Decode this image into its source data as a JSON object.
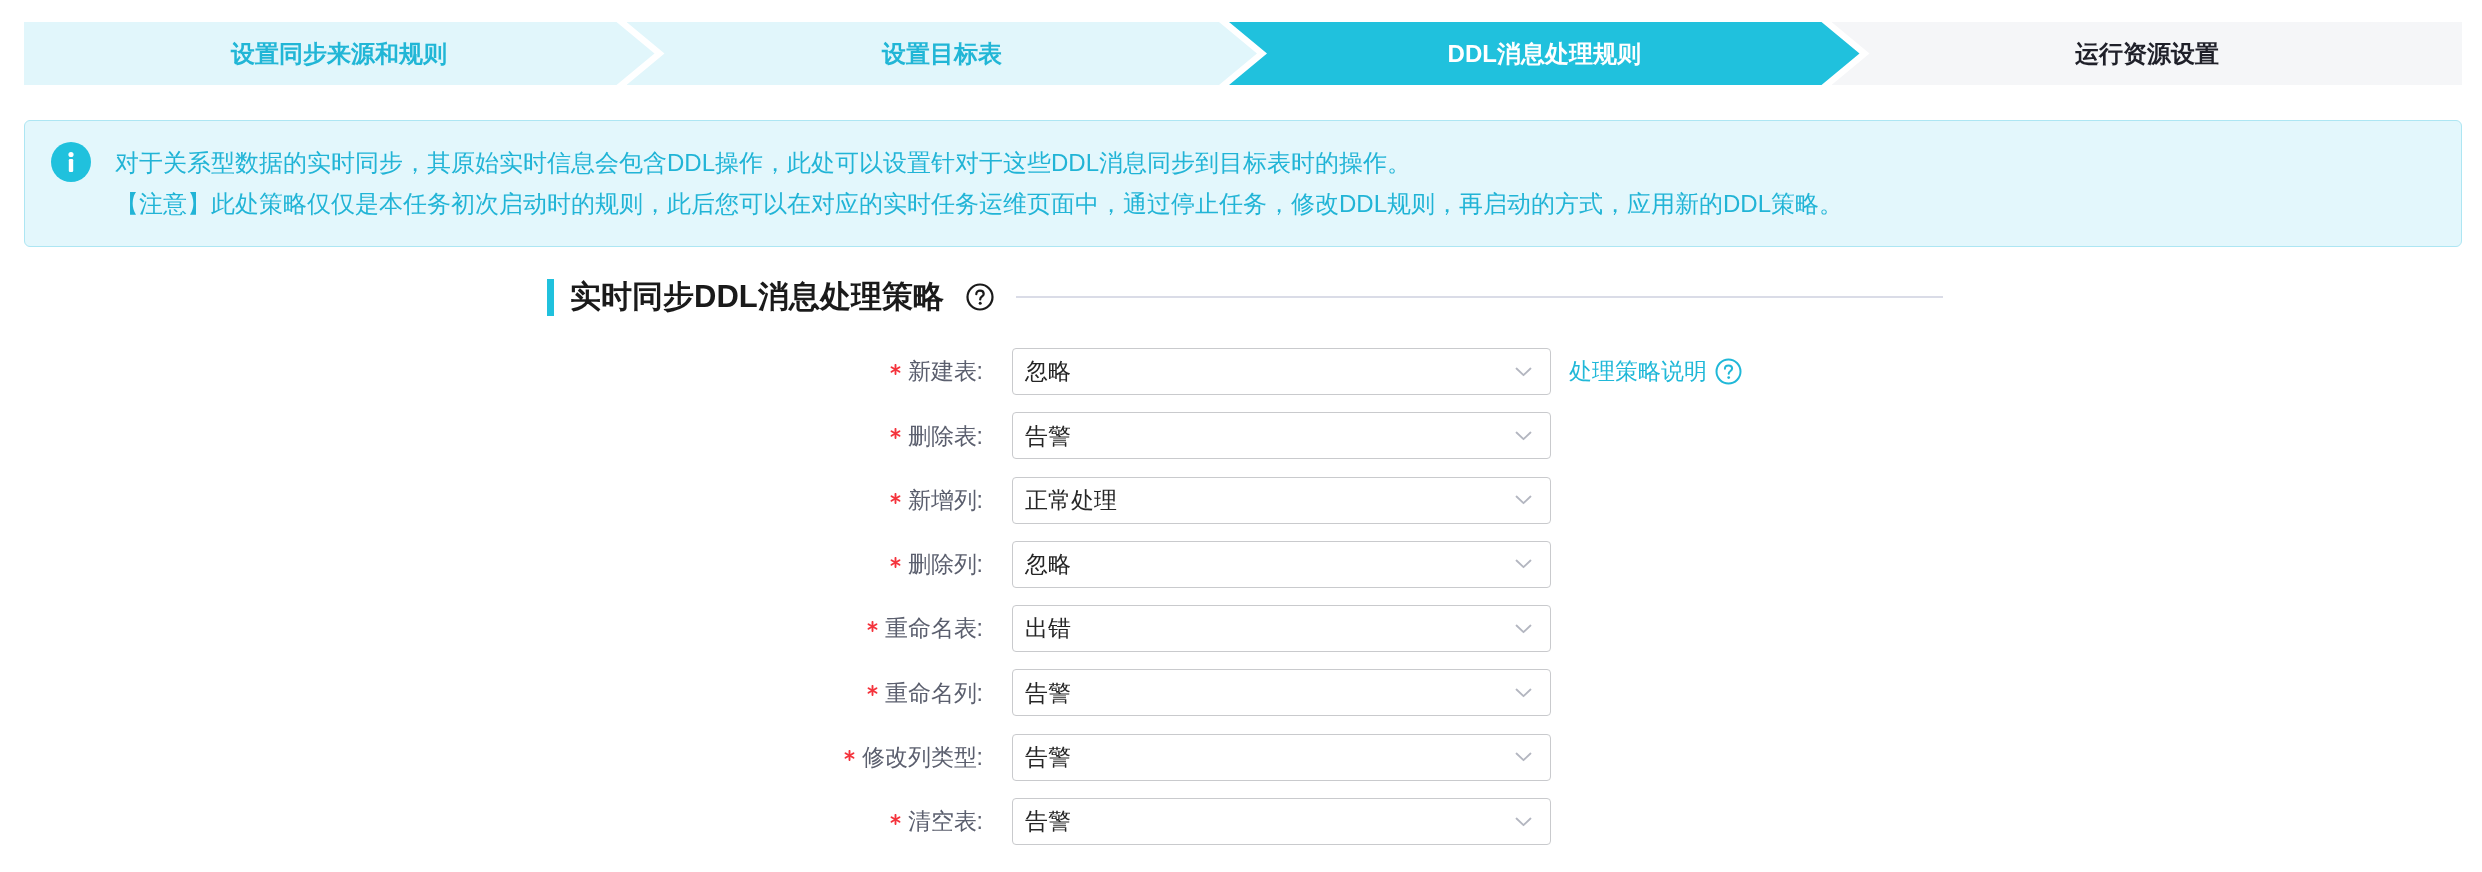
{
  "steps": [
    {
      "label": "设置同步来源和规则",
      "selected": false
    },
    {
      "label": "设置目标表",
      "selected": false
    },
    {
      "label": "DDL消息处理规则",
      "selected": true
    },
    {
      "label": "运行资源设置",
      "selected": false
    }
  ],
  "notice": {
    "lines": [
      "对于关系型数据的实时同步，其原始实时信息会包含DDL操作，此处可以设置针对于这些DDL消息同步到目标表时的操作。",
      "【注意】此处策略仅仅是本任务初次启动时的规则，此后您可以在对应的实时任务运维页面中，通过停止任务，修改DDL规则，再启动的方式，应用新的DDL策略。"
    ]
  },
  "section": {
    "title": "实时同步DDL消息处理策略"
  },
  "fields": [
    {
      "label": "新建表:",
      "required": true,
      "value": "忽略",
      "link": "处理策略说明"
    },
    {
      "label": "删除表:",
      "required": true,
      "value": "告警"
    },
    {
      "label": "新增列:",
      "required": true,
      "value": "正常处理"
    },
    {
      "label": "删除列:",
      "required": true,
      "value": "忽略"
    },
    {
      "label": "重命名表:",
      "required": true,
      "value": "出错"
    },
    {
      "label": "重命名列:",
      "required": true,
      "value": "告警"
    },
    {
      "label": "修改列类型:",
      "required": true,
      "value": "告警"
    },
    {
      "label": "清空表:",
      "required": true,
      "value": "告警"
    }
  ]
}
